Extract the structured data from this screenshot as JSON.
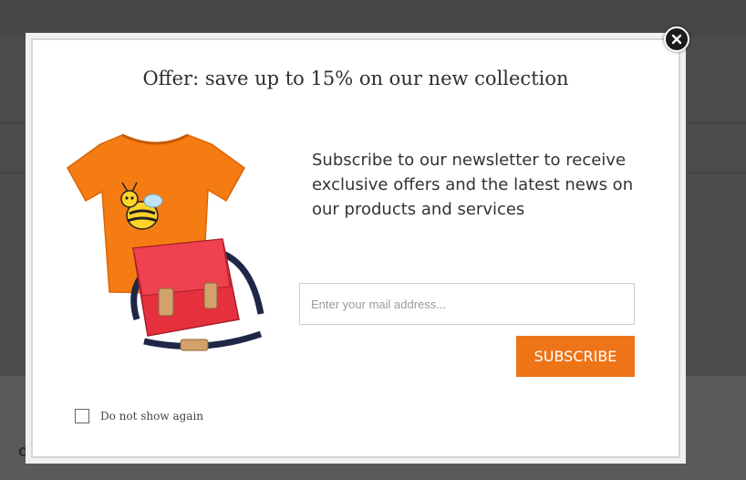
{
  "background": {
    "footer_text": "Office"
  },
  "popup": {
    "title": "Offer: save up to 15% on our new collection",
    "text": "Subscribe to our newsletter to receive exclusive offers and the latest news on our products and services",
    "email_placeholder": "Enter your mail address...",
    "email_value": "",
    "subscribe_label": "SUBSCRIBE",
    "dont_show_label": "Do not show again",
    "dont_show_checked": false
  },
  "colors": {
    "accent": "#ee7418",
    "overlay": "#4a4a4a",
    "tshirt": "#f57c12",
    "bag": "#e5303d"
  },
  "icons": {
    "close": "close-icon",
    "illustration": "tshirt-and-bag-image"
  }
}
